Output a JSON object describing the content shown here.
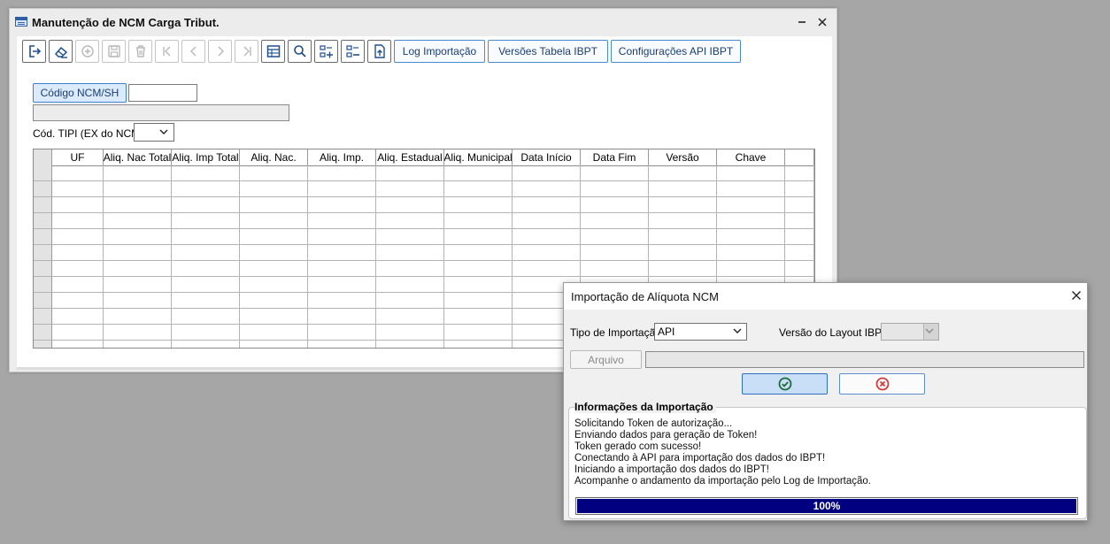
{
  "main_window": {
    "title": "Manutenção de NCM Carga Tribut.",
    "toolbar": {
      "log_importacao_label": "Log Importação",
      "versoes_tabela_label": "Versões Tabela IBPT",
      "configuracoes_api_label": "Configurações API IBPT"
    },
    "form": {
      "ncm_label": "Código NCM/SH",
      "ncm_value": "",
      "descricao_value": "",
      "tipi_label": "Cód. TIPI (EX do NCM)",
      "tipi_value": ""
    },
    "grid": {
      "columns": [
        "UF",
        "Aliq. Nac Total",
        "Aliq. Imp Total",
        "Aliq. Nac.",
        "Aliq. Imp.",
        "Aliq. Estadual",
        "Aliq. Municipal",
        "Data Início",
        "Data Fim",
        "Versão",
        "Chave"
      ]
    }
  },
  "dialog": {
    "title": "Importação de Alíquota NCM",
    "tipo_importacao_label": "Tipo de Importação",
    "tipo_importacao_value": "API",
    "versao_layout_label": "Versão do Layout IBPT",
    "versao_layout_value": "",
    "arquivo_label": "Arquivo",
    "arquivo_path": "",
    "info_group_title": "Informações da Importação",
    "log_lines": [
      "Solicitando Token de autorização...",
      "Enviando dados para geração de Token!",
      "Token gerado com sucesso!",
      "Conectando à API para importação dos dados do IBPT!",
      "Iniciando a importação dos dados do IBPT!",
      "Acompanhe o andamento da importação pelo Log de Importação."
    ],
    "progress": {
      "value": 1.0,
      "text": "100%"
    }
  },
  "colors": {
    "desktop": "#a6a6a6",
    "accent": "#4a8bd0",
    "progress_fill": "#000080",
    "cancel_red": "#d33a3a",
    "ok_green": "#1f6a3a"
  }
}
